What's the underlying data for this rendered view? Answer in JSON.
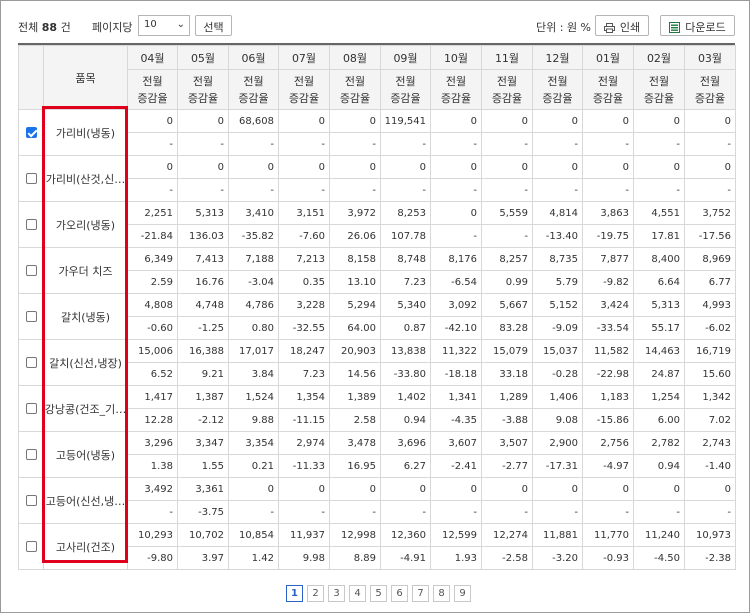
{
  "toolbar": {
    "total_prefix": "전체",
    "total_count": "88",
    "total_suffix": "건",
    "page_label": "페이지당",
    "page_size": "10",
    "select_button": "선택",
    "unit_label": "단위 : 원 %",
    "print_button": "인쇄",
    "download_button": "다운로드"
  },
  "table": {
    "item_header": "품목",
    "months": [
      "04월",
      "05월",
      "06월",
      "07월",
      "08월",
      "09월",
      "10월",
      "11월",
      "12월",
      "01월",
      "02월",
      "03월"
    ],
    "sub_header_line1": "전월",
    "sub_header_line2": "증감율",
    "rows": [
      {
        "name": "가리비(냉동)",
        "checked": true,
        "values": [
          "0",
          "0",
          "68,608",
          "0",
          "0",
          "119,541",
          "0",
          "0",
          "0",
          "0",
          "0",
          "0"
        ],
        "changes": [
          "-",
          "-",
          "-",
          "-",
          "-",
          "-",
          "-",
          "-",
          "-",
          "-",
          "-",
          "-"
        ]
      },
      {
        "name": "가리비(산것,신…",
        "checked": false,
        "values": [
          "0",
          "0",
          "0",
          "0",
          "0",
          "0",
          "0",
          "0",
          "0",
          "0",
          "0",
          "0"
        ],
        "changes": [
          "-",
          "-",
          "-",
          "-",
          "-",
          "-",
          "-",
          "-",
          "-",
          "-",
          "-",
          "-"
        ]
      },
      {
        "name": "가오리(냉동)",
        "checked": false,
        "values": [
          "2,251",
          "5,313",
          "3,410",
          "3,151",
          "3,972",
          "8,253",
          "0",
          "5,559",
          "4,814",
          "3,863",
          "4,551",
          "3,752"
        ],
        "changes": [
          "-21.84",
          "136.03",
          "-35.82",
          "-7.60",
          "26.06",
          "107.78",
          "-",
          "-",
          "-13.40",
          "-19.75",
          "17.81",
          "-17.56"
        ]
      },
      {
        "name": "가우더 치즈",
        "checked": false,
        "values": [
          "6,349",
          "7,413",
          "7,188",
          "7,213",
          "8,158",
          "8,748",
          "8,176",
          "8,257",
          "8,735",
          "7,877",
          "8,400",
          "8,969"
        ],
        "changes": [
          "2.59",
          "16.76",
          "-3.04",
          "0.35",
          "13.10",
          "7.23",
          "-6.54",
          "0.99",
          "5.79",
          "-9.82",
          "6.64",
          "6.77"
        ]
      },
      {
        "name": "갈치(냉동)",
        "checked": false,
        "values": [
          "4,808",
          "4,748",
          "4,786",
          "3,228",
          "5,294",
          "5,340",
          "3,092",
          "5,667",
          "5,152",
          "3,424",
          "5,313",
          "4,993"
        ],
        "changes": [
          "-0.60",
          "-1.25",
          "0.80",
          "-32.55",
          "64.00",
          "0.87",
          "-42.10",
          "83.28",
          "-9.09",
          "-33.54",
          "55.17",
          "-6.02"
        ]
      },
      {
        "name": "갈치(신선,냉장)",
        "checked": false,
        "values": [
          "15,006",
          "16,388",
          "17,017",
          "18,247",
          "20,903",
          "13,838",
          "11,322",
          "15,079",
          "15,037",
          "11,582",
          "14,463",
          "16,719"
        ],
        "changes": [
          "6.52",
          "9.21",
          "3.84",
          "7.23",
          "14.56",
          "-33.80",
          "-18.18",
          "33.18",
          "-0.28",
          "-22.98",
          "24.87",
          "15.60"
        ]
      },
      {
        "name": "강낭콩(건조_기…",
        "checked": false,
        "values": [
          "1,417",
          "1,387",
          "1,524",
          "1,354",
          "1,389",
          "1,402",
          "1,341",
          "1,289",
          "1,406",
          "1,183",
          "1,254",
          "1,342"
        ],
        "changes": [
          "12.28",
          "-2.12",
          "9.88",
          "-11.15",
          "2.58",
          "0.94",
          "-4.35",
          "-3.88",
          "9.08",
          "-15.86",
          "6.00",
          "7.02"
        ]
      },
      {
        "name": "고등어(냉동)",
        "checked": false,
        "values": [
          "3,296",
          "3,347",
          "3,354",
          "2,974",
          "3,478",
          "3,696",
          "3,607",
          "3,507",
          "2,900",
          "2,756",
          "2,782",
          "2,743"
        ],
        "changes": [
          "1.38",
          "1.55",
          "0.21",
          "-11.33",
          "16.95",
          "6.27",
          "-2.41",
          "-2.77",
          "-17.31",
          "-4.97",
          "0.94",
          "-1.40"
        ]
      },
      {
        "name": "고등어(신선,냉…",
        "checked": false,
        "values": [
          "3,492",
          "3,361",
          "0",
          "0",
          "0",
          "0",
          "0",
          "0",
          "0",
          "0",
          "0",
          "0"
        ],
        "changes": [
          "-",
          "-3.75",
          "-",
          "-",
          "-",
          "-",
          "-",
          "-",
          "-",
          "-",
          "-",
          "-"
        ]
      },
      {
        "name": "고사리(건조)",
        "checked": false,
        "values": [
          "10,293",
          "10,702",
          "10,854",
          "11,937",
          "12,998",
          "12,360",
          "12,599",
          "12,274",
          "11,881",
          "11,770",
          "11,240",
          "10,973"
        ],
        "changes": [
          "-9.80",
          "3.97",
          "1.42",
          "9.98",
          "8.89",
          "-4.91",
          "1.93",
          "-2.58",
          "-3.20",
          "-0.93",
          "-4.50",
          "-2.38"
        ]
      }
    ]
  },
  "pagination": {
    "pages": [
      "1",
      "2",
      "3",
      "4",
      "5",
      "6",
      "7",
      "8",
      "9"
    ],
    "active": "1"
  },
  "colors": {
    "highlight": "#e0001b",
    "checkbox_checked": "#1a73e8",
    "active_page": "#2a62c9"
  }
}
